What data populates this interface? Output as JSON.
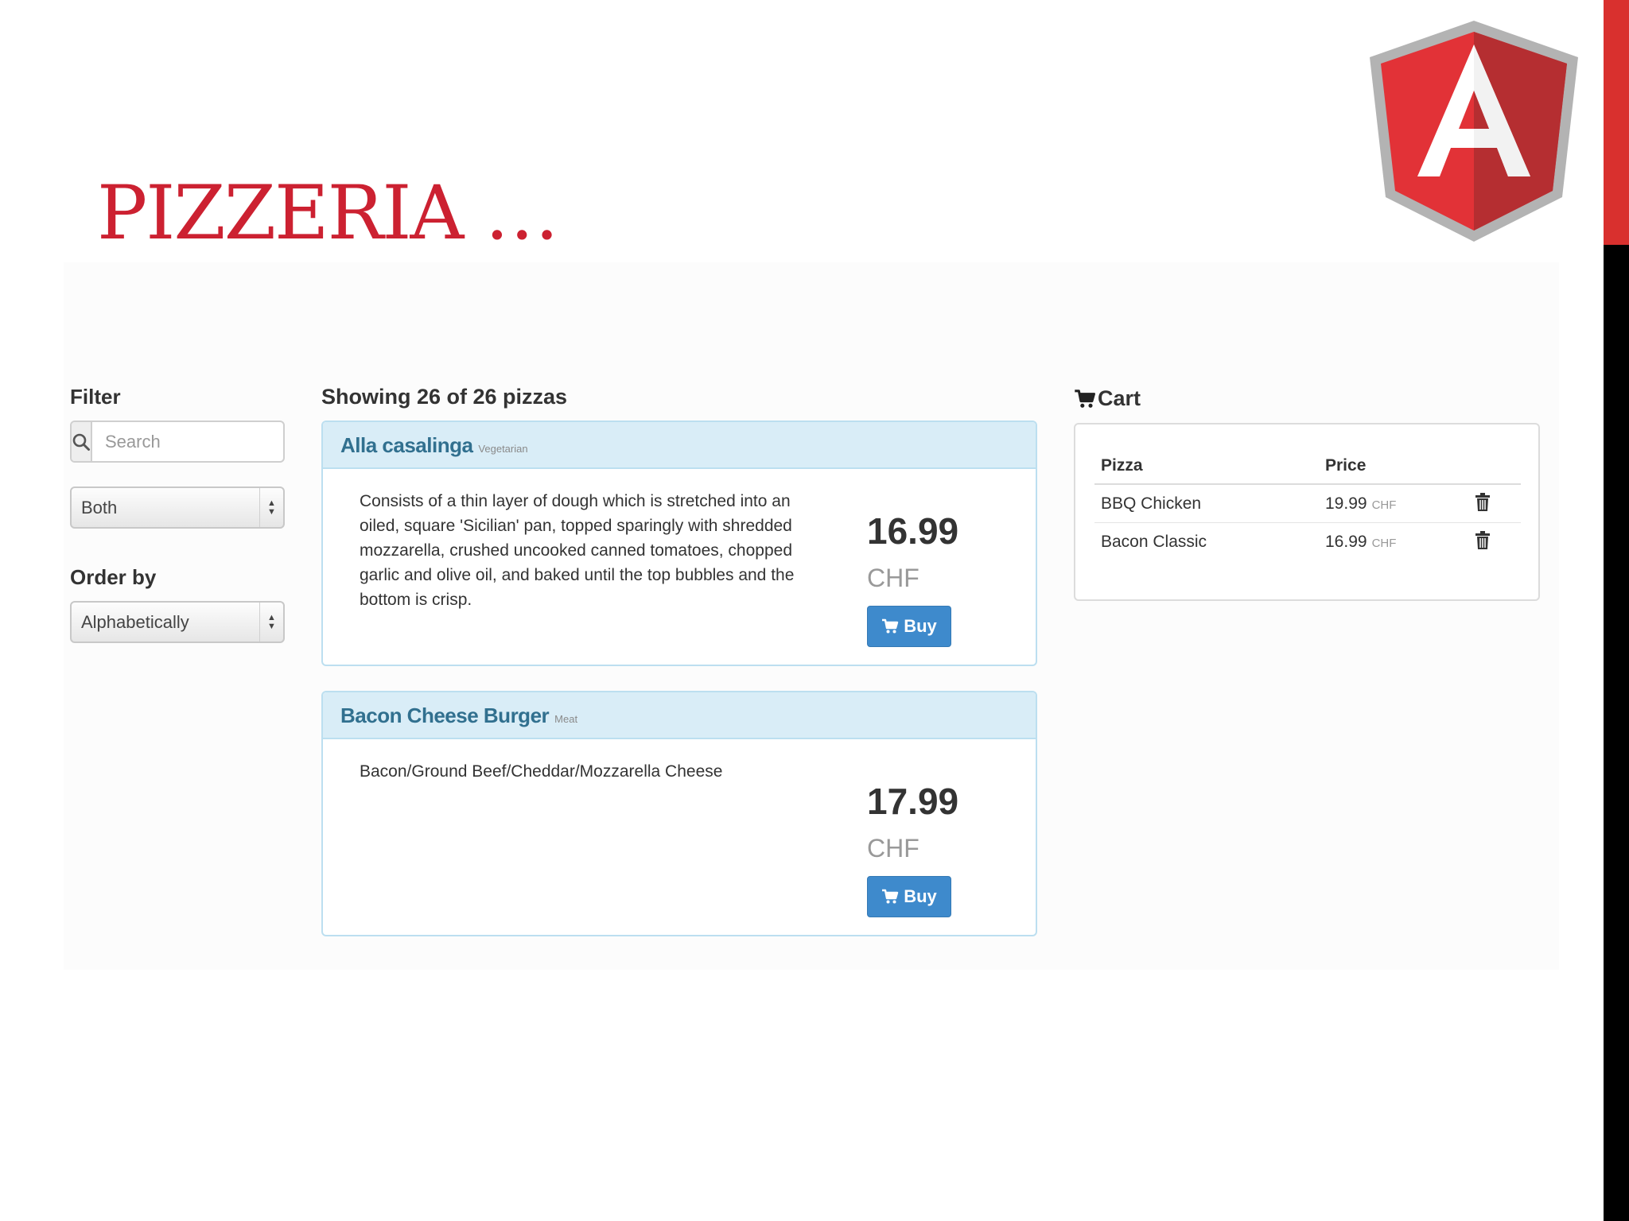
{
  "slide": {
    "title": "PIZZERIA …"
  },
  "filter": {
    "label": "Filter",
    "search_placeholder": "Search",
    "type_select": "Both",
    "order_label": "Order by",
    "order_select": "Alphabetically"
  },
  "listing": {
    "summary": "Showing 26 of 26 pizzas",
    "pizzas": [
      {
        "name": "Alla casalinga",
        "category": "Vegetarian",
        "description": "Consists of a thin layer of dough which is stretched into an oiled, square 'Sicilian' pan, topped sparingly with shredded mozzarella, crushed uncooked canned tomatoes, chopped garlic and olive oil, and baked until the top bubbles and the bottom is crisp.",
        "price": "16.99",
        "currency": "CHF",
        "buy_label": "Buy"
      },
      {
        "name": "Bacon Cheese Burger",
        "category": "Meat",
        "description": "Bacon/Ground Beef/Cheddar/Mozzarella Cheese",
        "price": "17.99",
        "currency": "CHF",
        "buy_label": "Buy"
      }
    ]
  },
  "cart": {
    "title": "Cart",
    "headers": {
      "pizza": "Pizza",
      "price": "Price"
    },
    "items": [
      {
        "pizza": "BBQ Chicken",
        "price": "19.99",
        "currency": "CHF"
      },
      {
        "pizza": "Bacon Classic",
        "price": "16.99",
        "currency": "CHF"
      }
    ]
  },
  "colors": {
    "title_red": "#cc2131",
    "panel_heading": "#d9edf7",
    "heading_text": "#31708f",
    "button_blue": "#3e8acc"
  },
  "icons": [
    "angular-logo",
    "search-icon",
    "cart-icon",
    "trash-icon",
    "select-arrows-icon"
  ]
}
